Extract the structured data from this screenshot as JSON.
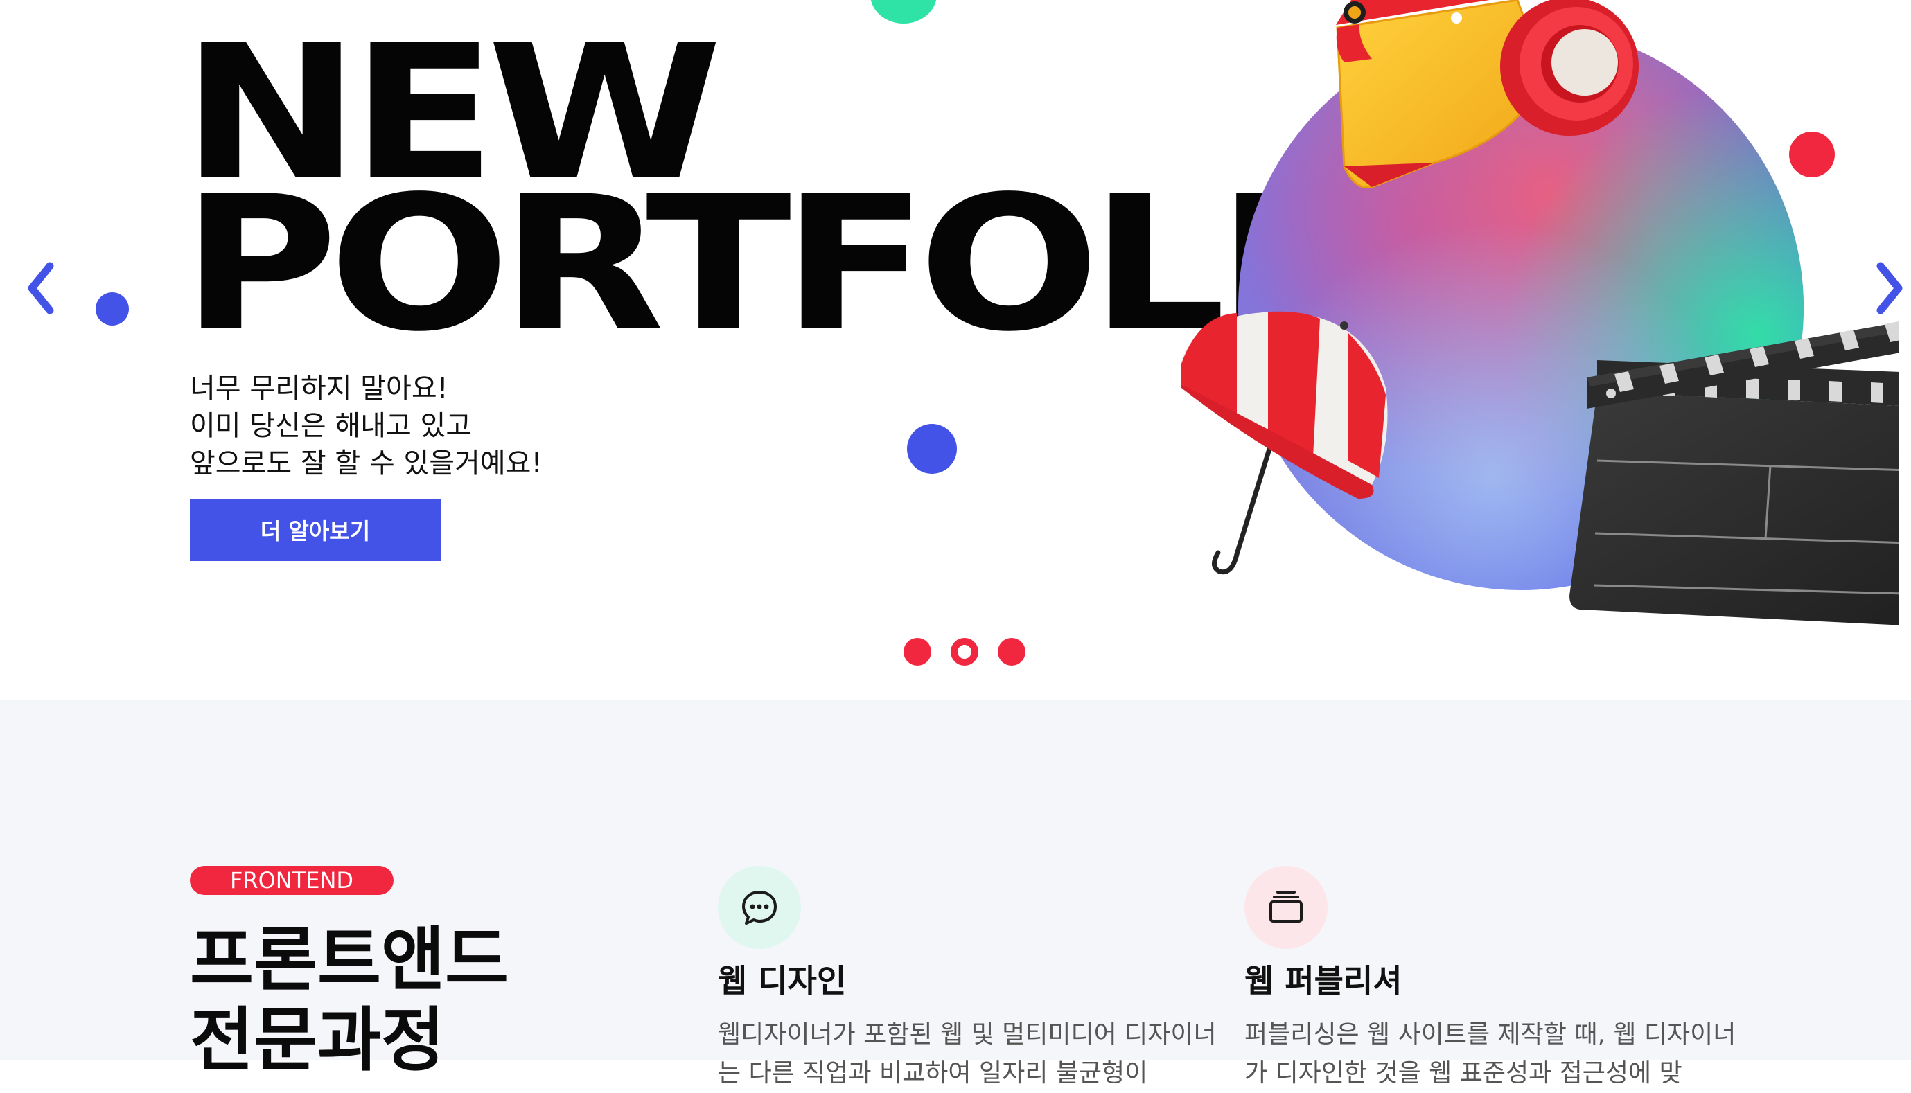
{
  "hero": {
    "headline_line1": "NEW",
    "headline_line2": "PORTFOLIO",
    "subtitle_lines": [
      "너무 무리하지 말아요!",
      "이미 당신은 해내고 있고",
      "앞으로도 잘 할 수 있을거예요!"
    ],
    "cta_label": "더 알아보기",
    "prev_arrow": "chevron-left-icon",
    "next_arrow": "chevron-right-icon",
    "pagination": {
      "total": 3,
      "current": 2
    }
  },
  "colors": {
    "accent_blue": "#4453e7",
    "accent_red": "#f0273f",
    "accent_green": "#2fe3a6",
    "section_bg": "#f5f6fa"
  },
  "section": {
    "badge": "FRONTEND",
    "title_lines": [
      "프론트앤드",
      "전문과정"
    ],
    "cards": [
      {
        "icon": "chat-bubble-icon",
        "title": "웹 디자인",
        "desc": "웹디자이너가 포함된 웹 및 멀티미디어 디자이너는 다른 직업과 비교하여 일자리 불균형이"
      },
      {
        "icon": "stack-layers-icon",
        "title": "웹 퍼블리셔",
        "desc": "퍼블리싱은 웹 사이트를 제작할 때, 웹 디자이너가 디자인한 것을 웹 표준성과 접근성에 맞"
      }
    ]
  }
}
